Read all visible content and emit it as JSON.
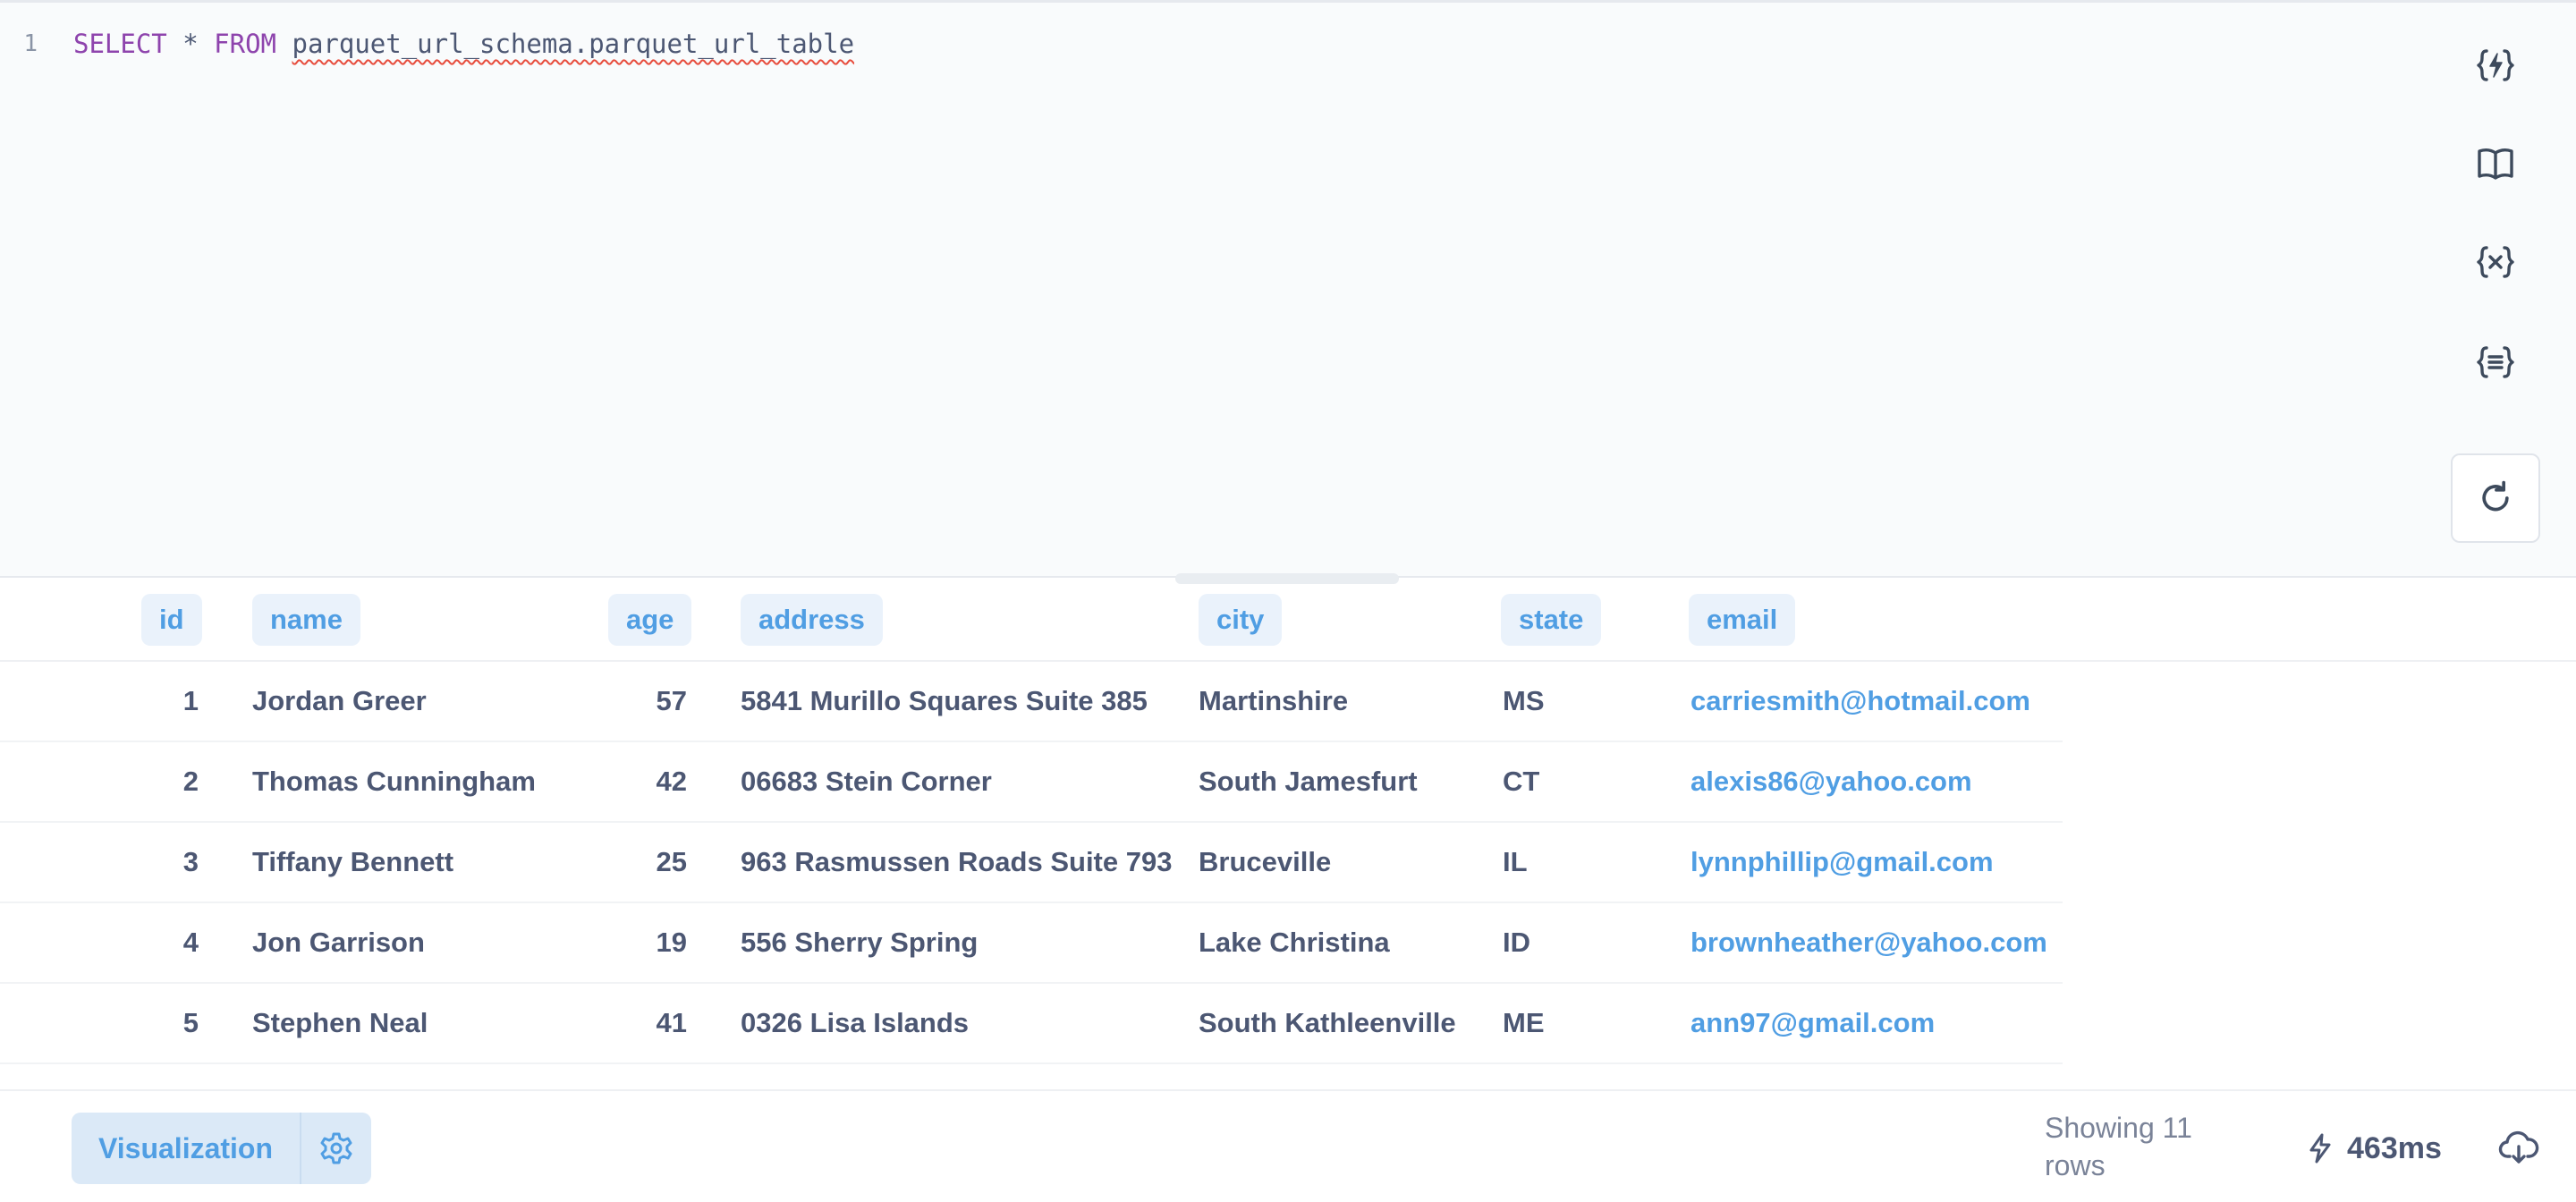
{
  "editor": {
    "line_number": "1",
    "query": {
      "select_kw": "SELECT",
      "star": "*",
      "from_kw": "FROM",
      "table_ref": "parquet_url_schema.parquet_url_table"
    },
    "side_icons": [
      "snippet-icon",
      "book-icon",
      "variables-icon",
      "template-icon",
      "refresh-icon"
    ]
  },
  "table": {
    "columns": [
      "id",
      "name",
      "age",
      "address",
      "city",
      "state",
      "email"
    ],
    "rows": [
      [
        "1",
        "Jordan Greer",
        "57",
        "5841 Murillo Squares Suite 385",
        "Martinshire",
        "MS",
        "carriesmith@hotmail.com"
      ],
      [
        "2",
        "Thomas Cunningham",
        "42",
        "06683 Stein Corner",
        "South Jamesfurt",
        "CT",
        "alexis86@yahoo.com"
      ],
      [
        "3",
        "Tiffany Bennett",
        "25",
        "963 Rasmussen Roads Suite 793",
        "Bruceville",
        "IL",
        "lynnphillip@gmail.com"
      ],
      [
        "4",
        "Jon Garrison",
        "19",
        "556 Sherry Spring",
        "Lake Christina",
        "ID",
        "brownheather@yahoo.com"
      ],
      [
        "5",
        "Stephen Neal",
        "41",
        "0326 Lisa Islands",
        "South Kathleenville",
        "ME",
        "ann97@gmail.com"
      ]
    ]
  },
  "footer": {
    "visualization_label": "Visualization",
    "row_count": "Showing 11 rows",
    "timing": "463ms"
  },
  "colors": {
    "accent": "#509ee3",
    "keyword": "#8e44ad",
    "text": "#4c5773",
    "error_underline": "#e74c3c"
  }
}
